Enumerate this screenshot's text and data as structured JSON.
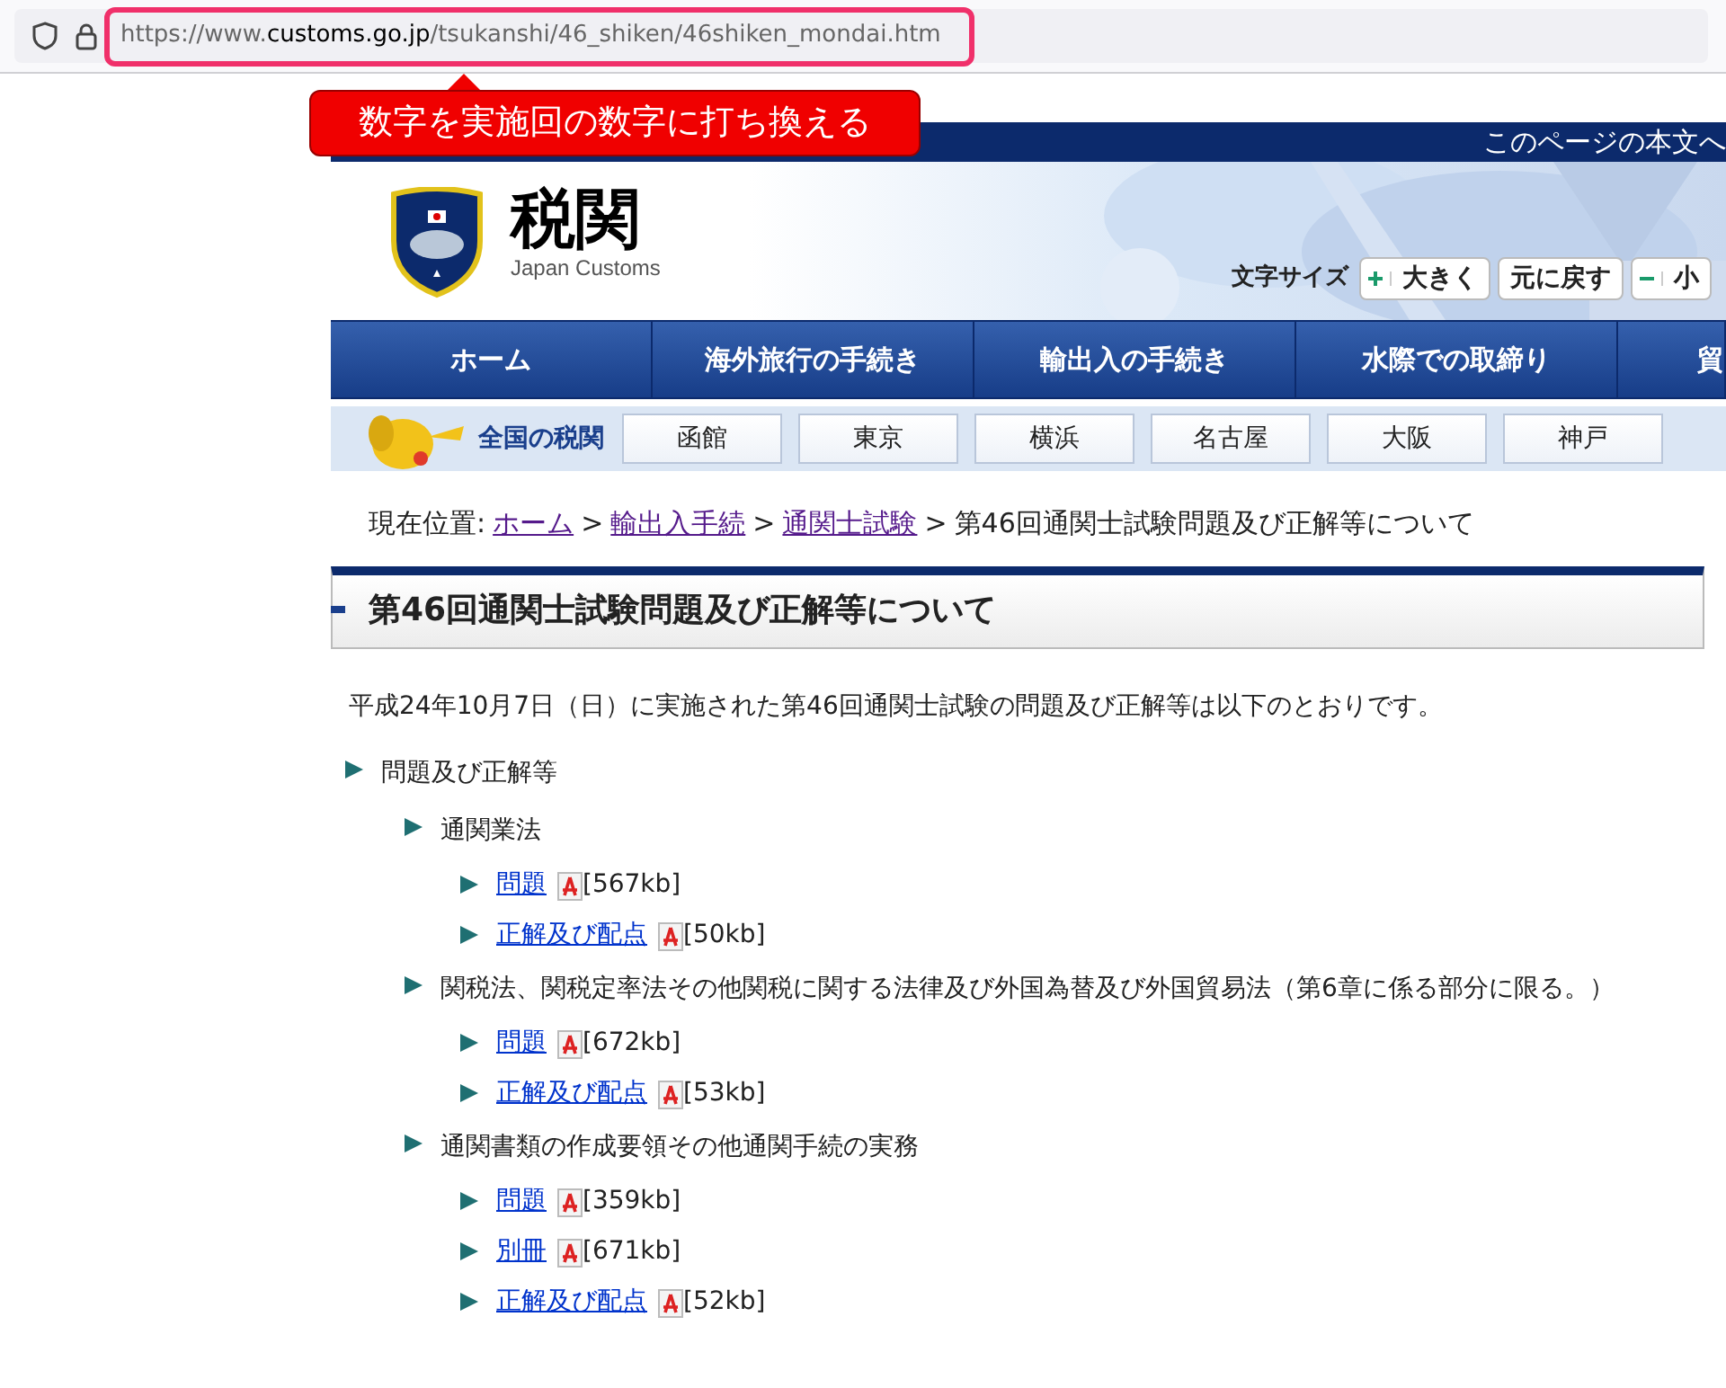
{
  "browser": {
    "url_prefix": "https://www.",
    "url_domain": "customs.go.jp",
    "url_path": "/tsukanshi/46_shiken/46shiken_mondai.htm"
  },
  "annotation": {
    "callout": "数字を実施回の数字に打ち換える"
  },
  "site": {
    "skip_link": "このページの本文へ",
    "title": "税関",
    "subtitle": "Japan Customs",
    "font_size": {
      "label": "文字サイズ",
      "buttons": [
        {
          "kind": "plus",
          "label": "大きく"
        },
        {
          "kind": "reset",
          "label": "元に戻す"
        },
        {
          "kind": "minus",
          "label": "小"
        }
      ]
    },
    "nav": [
      "ホーム",
      "海外旅行の手続き",
      "輸出入の手続き",
      "水際での取締り",
      "貿"
    ],
    "regional": {
      "label": "全国の税関",
      "offices": [
        "函館",
        "東京",
        "横浜",
        "名古屋",
        "大阪",
        "神戸"
      ]
    }
  },
  "breadcrumb": {
    "label": "現在位置:",
    "separator": ">",
    "links": [
      "ホーム",
      "輸出入手続",
      "通関士試験"
    ],
    "current": "第46回通関士試験問題及び正解等について"
  },
  "heading": "第46回通関士試験問題及び正解等について",
  "intro": "平成24年10月7日（日）に実施された第46回通関士試験の問題及び正解等は以下のとおりです。",
  "tree": [
    {
      "kind": "text",
      "label": "問題及び正解等",
      "children": [
        {
          "kind": "text",
          "label": "通関業法",
          "children": [
            {
              "kind": "link",
              "label": "問題",
              "size": "[567kb]"
            },
            {
              "kind": "link",
              "label": "正解及び配点",
              "size": "[50kb]"
            }
          ]
        },
        {
          "kind": "text",
          "label": "関税法、関税定率法その他関税に関する法律及び外国為替及び外国貿易法（第6章に係る部分に限る。）",
          "children": [
            {
              "kind": "link",
              "label": "問題",
              "size": "[672kb]"
            },
            {
              "kind": "link",
              "label": "正解及び配点",
              "size": "[53kb]"
            }
          ]
        },
        {
          "kind": "text",
          "label": "通関書類の作成要領その他通関手続の実務",
          "children": [
            {
              "kind": "link",
              "label": "問題",
              "size": "[359kb]"
            },
            {
              "kind": "link",
              "label": "別冊",
              "size": "[671kb]"
            },
            {
              "kind": "link",
              "label": "正解及び配点",
              "size": "[52kb]"
            }
          ]
        }
      ]
    }
  ]
}
